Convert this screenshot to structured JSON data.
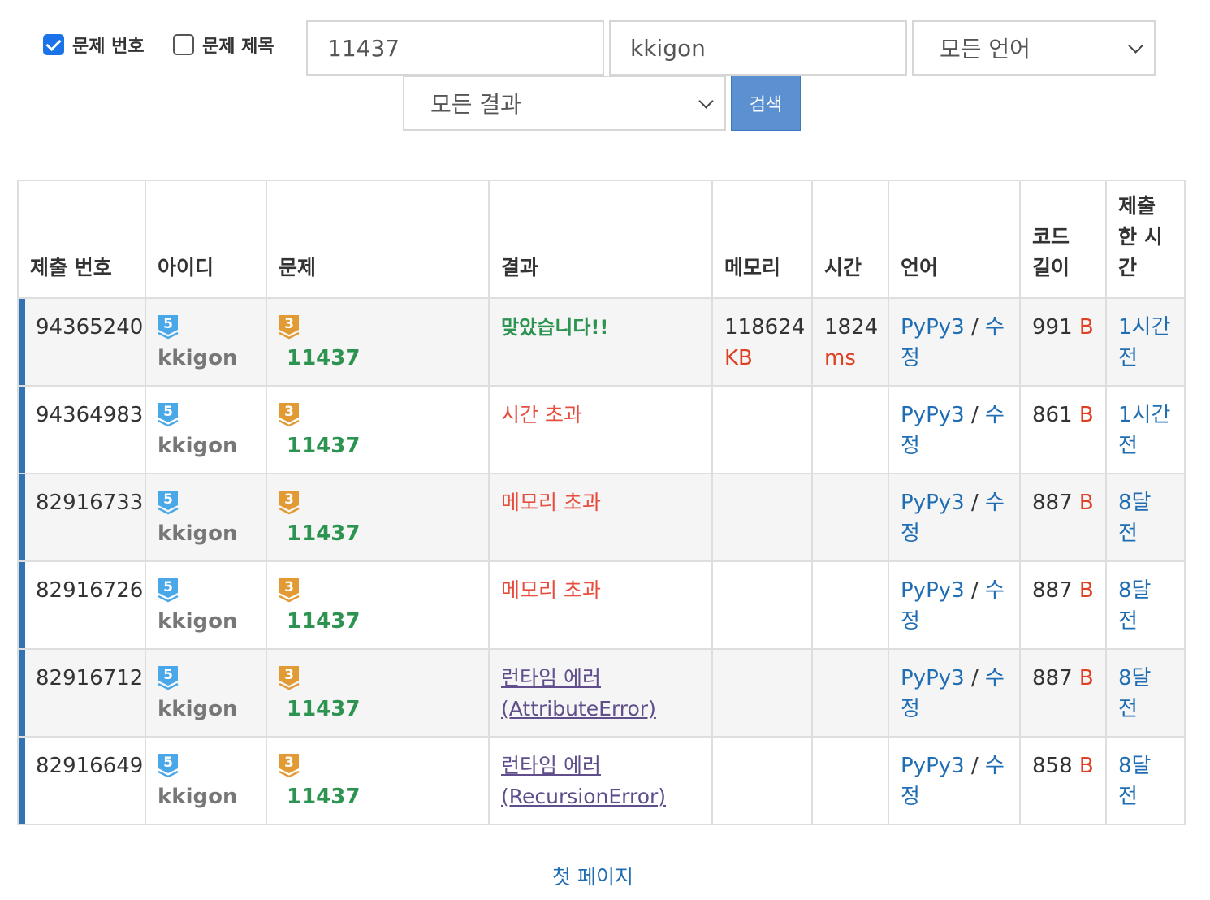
{
  "filters": {
    "problem_number_label": "문제 번호",
    "problem_number_checked": true,
    "problem_title_label": "문제 제목",
    "problem_title_checked": false,
    "problem_value": "11437",
    "user_value": "kkigon",
    "language_select": "모든 언어",
    "result_select": "모든 결과",
    "search_button": "검색"
  },
  "table": {
    "headers": {
      "submission": "제출 번호",
      "user": "아이디",
      "problem": "문제",
      "result": "결과",
      "memory": "메모리",
      "time": "시간",
      "language": "언어",
      "code_length": "코드 길이",
      "submitted_at": "제출한 시간"
    },
    "rows": [
      {
        "id": "94365240",
        "user_tier": "5",
        "user": "kkigon",
        "problem_tier": "3",
        "problem": "11437",
        "result": "맞았습니다!!",
        "result_type": "ac",
        "memory": "118624",
        "memory_unit": "KB",
        "time": "1824",
        "time_unit": "ms",
        "language": "PyPy3",
        "edit": "수정",
        "code_length": "991",
        "code_unit": "B",
        "submitted": "1시간 전"
      },
      {
        "id": "94364983",
        "user_tier": "5",
        "user": "kkigon",
        "problem_tier": "3",
        "problem": "11437",
        "result": "시간 초과",
        "result_type": "err",
        "memory": "",
        "memory_unit": "",
        "time": "",
        "time_unit": "",
        "language": "PyPy3",
        "edit": "수정",
        "code_length": "861",
        "code_unit": "B",
        "submitted": "1시간 전"
      },
      {
        "id": "82916733",
        "user_tier": "5",
        "user": "kkigon",
        "problem_tier": "3",
        "problem": "11437",
        "result": "메모리 초과",
        "result_type": "err",
        "memory": "",
        "memory_unit": "",
        "time": "",
        "time_unit": "",
        "language": "PyPy3",
        "edit": "수정",
        "code_length": "887",
        "code_unit": "B",
        "submitted": "8달 전"
      },
      {
        "id": "82916726",
        "user_tier": "5",
        "user": "kkigon",
        "problem_tier": "3",
        "problem": "11437",
        "result": "메모리 초과",
        "result_type": "err",
        "memory": "",
        "memory_unit": "",
        "time": "",
        "time_unit": "",
        "language": "PyPy3",
        "edit": "수정",
        "code_length": "887",
        "code_unit": "B",
        "submitted": "8달 전"
      },
      {
        "id": "82916712",
        "user_tier": "5",
        "user": "kkigon",
        "problem_tier": "3",
        "problem": "11437",
        "result": "런타임 에러 (AttributeError)",
        "result_type": "rte",
        "memory": "",
        "memory_unit": "",
        "time": "",
        "time_unit": "",
        "language": "PyPy3",
        "edit": "수정",
        "code_length": "887",
        "code_unit": "B",
        "submitted": "8달 전"
      },
      {
        "id": "82916649",
        "user_tier": "5",
        "user": "kkigon",
        "problem_tier": "3",
        "problem": "11437",
        "result": "런타임 에러 (RecursionError)",
        "result_type": "rte",
        "memory": "",
        "memory_unit": "",
        "time": "",
        "time_unit": "",
        "language": "PyPy3",
        "edit": "수정",
        "code_length": "858",
        "code_unit": "B",
        "submitted": "8달 전"
      }
    ]
  },
  "pager": {
    "first_page": "첫 페이지"
  },
  "colors": {
    "user_tier_badge": "#4aa8e8",
    "problem_tier_badge": "#e29b34",
    "accepted": "#2c9350",
    "error": "#e74c3c",
    "runtime_error": "#5f4d8c",
    "link": "#1f6db3",
    "row_marker": "#3273b3"
  }
}
